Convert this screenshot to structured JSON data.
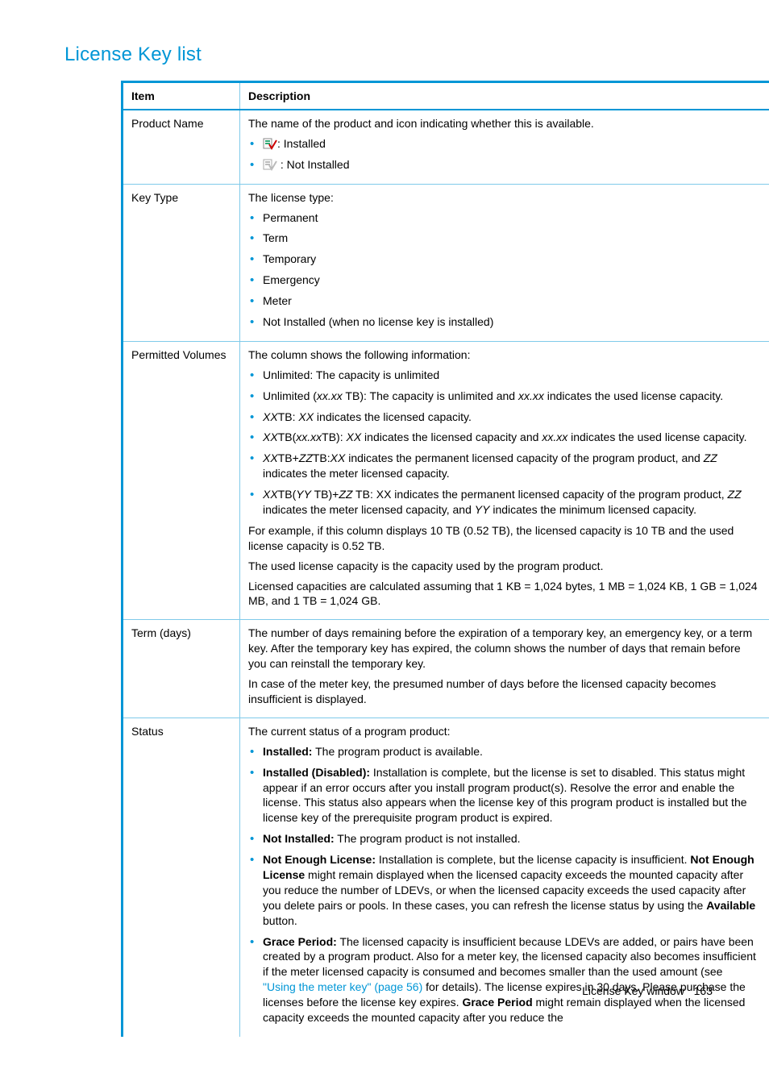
{
  "title": "License Key list",
  "footer": {
    "label": "License Key window",
    "page": "163"
  },
  "headers": {
    "item": "Item",
    "description": "Description"
  },
  "rows": {
    "product_name": {
      "item": "Product Name",
      "intro": "The name of the product and icon indicating whether this is available.",
      "icons": {
        "installed": ": Installed",
        "not_installed": " : Not Installed"
      }
    },
    "key_type": {
      "item": "Key Type",
      "intro": "The license type:",
      "items": [
        "Permanent",
        "Term",
        "Temporary",
        "Emergency",
        "Meter",
        "Not Installed (when no license key is installed)"
      ]
    },
    "permitted_volumes": {
      "item": "Permitted Volumes",
      "intro": "The column shows the following information:",
      "li1a": "Unlimited: The capacity is unlimited",
      "li2a": "Unlimited (",
      "li2b": "xx.xx",
      "li2c": " TB): The capacity is unlimited and ",
      "li2d": "xx.xx",
      "li2e": " indicates the used license capacity.",
      "li3a": "XX",
      "li3b": "TB: ",
      "li3c": "XX",
      "li3d": " indicates the licensed capacity.",
      "li4a": "XX",
      "li4b": "TB(",
      "li4c": "xx.xx",
      "li4d": "TB): ",
      "li4e": "XX",
      "li4f": " indicates the licensed capacity and ",
      "li4g": "xx.xx",
      "li4h": " indicates the used license capacity.",
      "li5a": "XX",
      "li5b": "TB+",
      "li5c": "ZZ",
      "li5d": "TB:",
      "li5e": "XX",
      "li5f": " indicates the permanent licensed capacity of the program product, and ",
      "li5g": "ZZ",
      "li5h": " indicates the meter licensed capacity.",
      "li6a": "XX",
      "li6b": "TB(",
      "li6c": "YY",
      "li6d": " TB)+",
      "li6e": "ZZ",
      "li6f": " TB: XX indicates the permanent licensed capacity of the program product, ",
      "li6g": "ZZ",
      "li6h": " indicates the meter licensed capacity, and ",
      "li6i": "YY",
      "li6j": " indicates the minimum licensed capacity.",
      "p1": "For example, if this column displays 10 TB (0.52 TB), the licensed capacity is 10 TB and the used license capacity is 0.52 TB.",
      "p2": "The used license capacity is the capacity used by the program product.",
      "p3": "Licensed capacities are calculated assuming that 1 KB = 1,024 bytes, 1 MB = 1,024 KB, 1 GB = 1,024 MB, and 1 TB = 1,024 GB."
    },
    "term_days": {
      "item": "Term (days)",
      "p1": "The number of days remaining before the expiration of a temporary key, an emergency key, or a term key. After the temporary key has expired, the column shows the number of days that remain before you can reinstall the temporary key.",
      "p2": "In case of the meter key, the presumed number of days before the licensed capacity becomes insufficient is displayed."
    },
    "status": {
      "item": "Status",
      "intro": "The current status of a program product:",
      "s1a": "Installed:",
      "s1b": " The program product is available.",
      "s2a": "Installed (Disabled):",
      "s2b": " Installation is complete, but the license is set to disabled. This status might appear if an error occurs after you install program product(s). Resolve the error and enable the license. This status also appears when the license key of this program product is installed but the license key of the prerequisite program product is expired.",
      "s3a": "Not Installed:",
      "s3b": " The program product is not installed.",
      "s4a": "Not Enough License:",
      "s4b": " Installation is complete, but the license capacity is insufficient. ",
      "s4c": "Not Enough License",
      "s4d": " might remain displayed when the licensed capacity exceeds the mounted capacity after you reduce the number of LDEVs, or when the licensed capacity exceeds the used capacity after you delete pairs or pools. In these cases, you can refresh the license status by using the ",
      "s4e": "Available",
      "s4f": " button.",
      "s5a": "Grace Period:",
      "s5b": " The licensed capacity is insufficient because LDEVs are added, or pairs have been created by a program product. Also for a meter key, the licensed capacity also becomes insufficient if the meter licensed capacity is consumed and becomes smaller than the used amount (see ",
      "s5link": "\"Using the meter key\" (page 56)",
      "s5c": " for details). The license expires in 30 days. Please purchase the licenses before the license key expires. ",
      "s5d": "Grace Period",
      "s5e": " might remain displayed when the licensed capacity exceeds the mounted capacity after you reduce the"
    }
  }
}
